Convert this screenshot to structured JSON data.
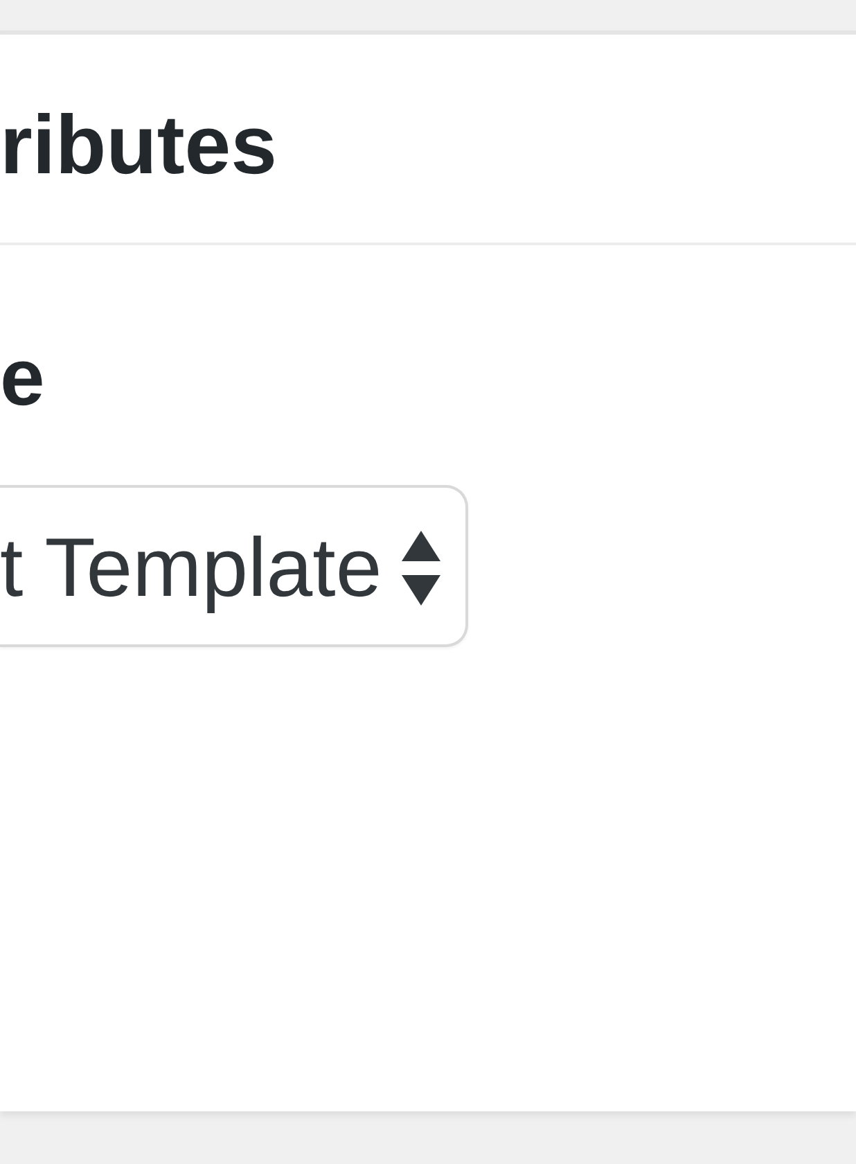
{
  "panel": {
    "title": "ributes",
    "fields": [
      {
        "kind": "select",
        "label": "e",
        "value": "t Template"
      }
    ]
  }
}
